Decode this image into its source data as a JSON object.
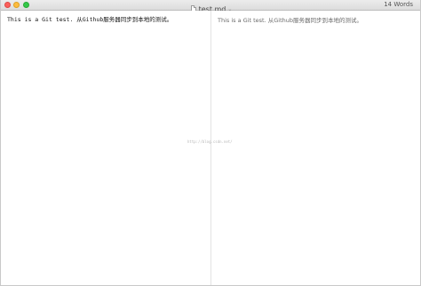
{
  "window": {
    "title": "test.md",
    "chevron": "⌄",
    "word_count": "14 Words",
    "traffic_colors": {
      "close": "#fc605c",
      "minimize": "#fdbc40",
      "maximize": "#34c84a"
    }
  },
  "icons": {
    "document": "document-icon",
    "close": "close-icon",
    "minimize": "minimize-icon",
    "maximize": "maximize-icon"
  },
  "editor": {
    "text": "This is a Git test. 从Github服务器同步到本地的测试。"
  },
  "preview": {
    "text": "This is a Git test. 从Github服务器同步到本地的测试。"
  },
  "watermark": {
    "text": "http://blog.csdn.net/"
  }
}
